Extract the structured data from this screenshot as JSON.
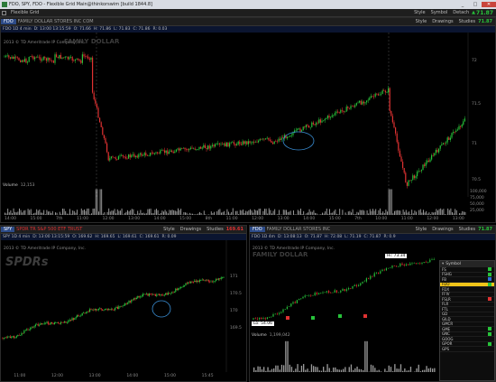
{
  "window": {
    "title": "FDO, SPY, FDO - Flexible Grid Main@thinkorswim [build 1844.8]",
    "minimize": "_",
    "maximize": "□",
    "close": "✕"
  },
  "toolbar": {
    "layout_label": "Flexible Grid",
    "style": "Style",
    "symbol": "Symbol",
    "detach": "Detach",
    "price": "71.87",
    "price_arrow": "▲"
  },
  "top_chart": {
    "symbol": "FDO",
    "name": "FAMILY DOLLAR STORES INC COM",
    "btn_style": "Style",
    "btn_drawings": "Drawings",
    "btn_studies": "Studies",
    "price": "71.87",
    "ohlc": [
      "FDO 1D 4 min",
      "D: 13:00 13:15:59",
      "O: 71.66",
      "H: 71.86",
      "L: 71.83",
      "C: 71.86",
      "R: 0.03"
    ],
    "copyright": "2013 © TD Ameritrade IP Company, Inc.",
    "watermark": "FAMILY DOLLAR",
    "y_ticks": [
      "72",
      "71.5",
      "71",
      "70.5"
    ],
    "x_ticks": [
      "14:00",
      "15:00",
      "7th",
      "11:00",
      "12:00",
      "13:00",
      "14:00",
      "15:00",
      "8th",
      "11:00",
      "12:00",
      "13:00",
      "14:00",
      "15:00",
      "7th",
      "10:00",
      "11:00",
      "12:00",
      "13:00"
    ],
    "volume_label": "Volume",
    "volume_value": "12,153",
    "vol_ticks": [
      "100,000",
      "75,000",
      "50,000",
      "25,000"
    ]
  },
  "spy_chart": {
    "symbol": "SPY",
    "name": "SPDR TR S&P 500 ETF TRUST",
    "btn_style": "Style",
    "btn_drawings": "Drawings",
    "btn_studies": "Studies",
    "price": "169.61",
    "ohlc": [
      "SPY 1D 4 min",
      "D: 13:00 13:15:59",
      "O: 169.62",
      "H: 169.65",
      "L: 169.61",
      "C: 169.61",
      "R: 0.09"
    ],
    "copyright": "2013 © TD Ameritrade IP Company, Inc.",
    "watermark": "SPDRs",
    "y_ticks": [
      "171",
      "170.5",
      "170",
      "169.5"
    ],
    "x_ticks": [
      "11:00",
      "12:00",
      "13:00",
      "14:00",
      "15:00",
      "15:45"
    ]
  },
  "fdo_chart": {
    "symbol": "FDO",
    "name": "FAMILY DOLLAR STORES INC",
    "btn_style": "Style",
    "btn_drawings": "Drawings",
    "btn_studies": "Studies",
    "price": "71.87",
    "ohlc": [
      "FDO 1D 4m",
      "D: 13:08:13",
      "O: 71.87",
      "H: 72.08",
      "L: 71.19",
      "C: 71.87",
      "R: 0.9"
    ],
    "copyright": "2013 © TD Ameritrade IP Company, Inc.",
    "watermark": "FAMILY DOLLAR",
    "high_label": "Hi: 73.34",
    "low_label": "Lo: 54.06",
    "volume_label": "Volume",
    "volume_value": "1,199,042"
  },
  "watchlist": {
    "header": "Symbol",
    "rows": [
      "FS",
      "FSHG",
      "FB",
      "FDO",
      "FDX",
      "FFIV",
      "FSLR",
      "FLR",
      "FTL",
      "GD",
      "GILD",
      "GMCR",
      "GME",
      "GNC",
      "GOOG",
      "GPOR",
      "GPS"
    ],
    "selected": "FDO"
  },
  "colors": {
    "up": "#27c23a",
    "down": "#e03232",
    "accent": "#e8a326",
    "annotation": "#3a8fd6"
  }
}
